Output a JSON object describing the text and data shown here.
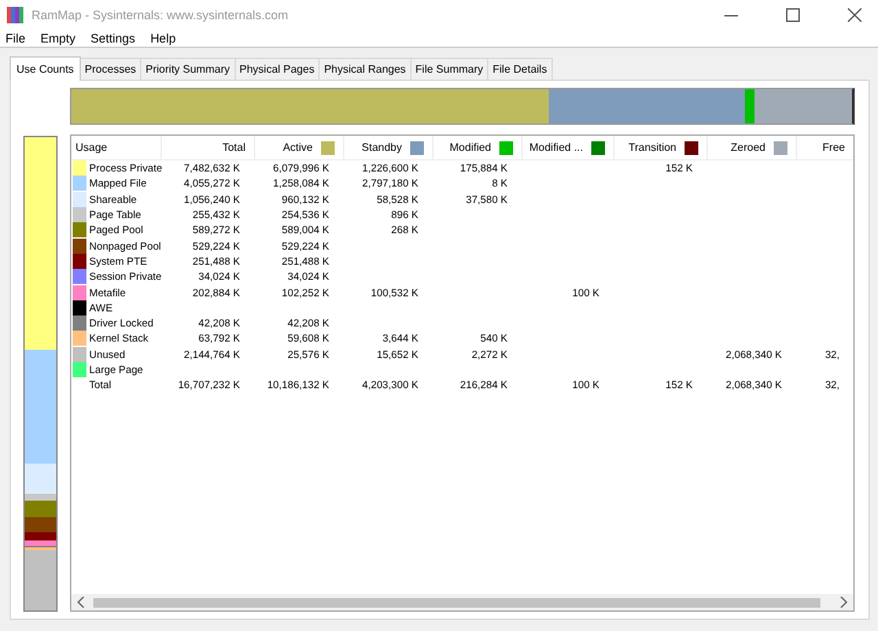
{
  "window": {
    "title": "RamMap - Sysinternals: www.sysinternals.com"
  },
  "menu": [
    "File",
    "Empty",
    "Settings",
    "Help"
  ],
  "tabs": [
    {
      "label": "Use Counts",
      "selected": true
    },
    {
      "label": "Processes",
      "selected": false
    },
    {
      "label": "Priority Summary",
      "selected": false
    },
    {
      "label": "Physical Pages",
      "selected": false
    },
    {
      "label": "Physical Ranges",
      "selected": false
    },
    {
      "label": "File Summary",
      "selected": false
    },
    {
      "label": "File Details",
      "selected": false
    }
  ],
  "table": {
    "columns": [
      {
        "label": "Usage"
      },
      {
        "label": "Total"
      },
      {
        "label": "Active",
        "color": "#bdbb5e"
      },
      {
        "label": "Standby",
        "color": "#7f9bbb"
      },
      {
        "label": "Modified",
        "color": "#00c000"
      },
      {
        "label": "Modified ...",
        "color": "#008000"
      },
      {
        "label": "Transition",
        "color": "#6b0000"
      },
      {
        "label": "Zeroed",
        "color": "#a0aab5"
      },
      {
        "label": "Free"
      }
    ],
    "rows": [
      {
        "kind": "usage",
        "color": "#ffff80",
        "cells": [
          "Process Private",
          "7,482,632 K",
          "6,079,996 K",
          "1,226,600 K",
          "175,884 K",
          "",
          "152 K",
          "",
          ""
        ]
      },
      {
        "kind": "usage",
        "color": "#a6d2ff",
        "cells": [
          "Mapped File",
          "4,055,272 K",
          "1,258,084 K",
          "2,797,180 K",
          "8 K",
          "",
          "",
          "",
          ""
        ]
      },
      {
        "kind": "usage",
        "color": "#dcecff",
        "cells": [
          "Shareable",
          "1,056,240 K",
          "960,132 K",
          "58,528 K",
          "37,580 K",
          "",
          "",
          "",
          ""
        ]
      },
      {
        "kind": "usage",
        "color": "#c8c8c8",
        "cells": [
          "Page Table",
          "255,432 K",
          "254,536 K",
          "896 K",
          "",
          "",
          "",
          "",
          ""
        ]
      },
      {
        "kind": "usage",
        "color": "#808000",
        "cells": [
          "Paged Pool",
          "589,272 K",
          "589,004 K",
          "268 K",
          "",
          "",
          "",
          "",
          ""
        ]
      },
      {
        "kind": "usage",
        "color": "#804000",
        "cells": [
          "Nonpaged Pool",
          "529,224 K",
          "529,224 K",
          "",
          "",
          "",
          "",
          "",
          ""
        ]
      },
      {
        "kind": "usage",
        "color": "#800000",
        "cells": [
          "System PTE",
          "251,488 K",
          "251,488 K",
          "",
          "",
          "",
          "",
          "",
          ""
        ]
      },
      {
        "kind": "usage",
        "color": "#8080ff",
        "cells": [
          "Session Private",
          "34,024 K",
          "34,024 K",
          "",
          "",
          "",
          "",
          "",
          ""
        ]
      },
      {
        "kind": "usage",
        "color": "#ff80c0",
        "cells": [
          "Metafile",
          "202,884 K",
          "102,252 K",
          "100,532 K",
          "",
          "100 K",
          "",
          "",
          ""
        ]
      },
      {
        "kind": "usage",
        "color": "#000000",
        "cells": [
          "AWE",
          "",
          "",
          "",
          "",
          "",
          "",
          "",
          ""
        ]
      },
      {
        "kind": "usage",
        "color": "#808080",
        "cells": [
          "Driver Locked",
          "42,208 K",
          "42,208 K",
          "",
          "",
          "",
          "",
          "",
          ""
        ]
      },
      {
        "kind": "usage",
        "color": "#ffc080",
        "cells": [
          "Kernel Stack",
          "63,792 K",
          "59,608 K",
          "3,644 K",
          "540 K",
          "",
          "",
          "",
          ""
        ]
      },
      {
        "kind": "usage",
        "color": "#c0c0c0",
        "cells": [
          "Unused",
          "2,144,764 K",
          "25,576 K",
          "15,652 K",
          "2,272 K",
          "",
          "",
          "2,068,340 K",
          "32,"
        ]
      },
      {
        "kind": "usage",
        "color": "#40ff80",
        "cells": [
          "Large Page",
          "",
          "",
          "",
          "",
          "",
          "",
          "",
          ""
        ]
      },
      {
        "kind": "total",
        "cells": [
          "Total",
          "16,707,232 K",
          "10,186,132 K",
          "4,203,300 K",
          "216,284 K",
          "100 K",
          "152 K",
          "2,068,340 K",
          "32,"
        ]
      }
    ]
  }
}
